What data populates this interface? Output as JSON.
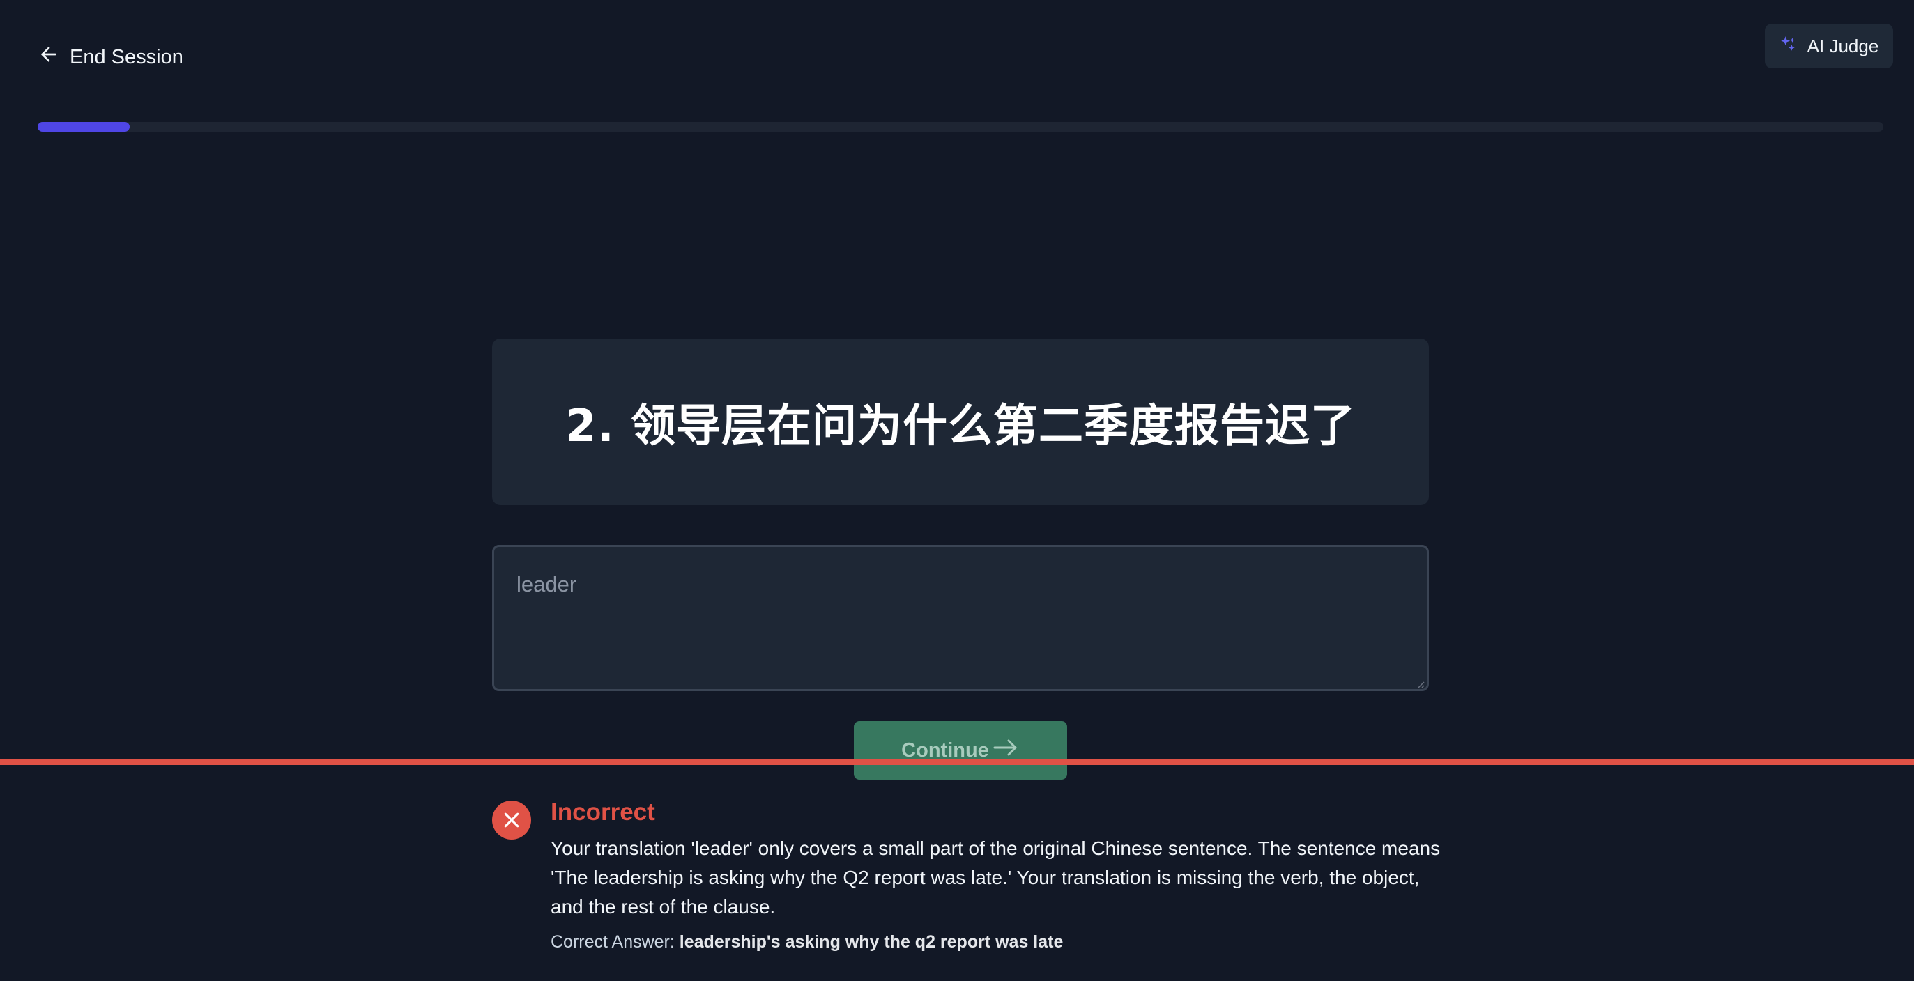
{
  "header": {
    "end_session_label": "End Session",
    "ai_judge_label": "AI Judge"
  },
  "progress": {
    "fraction": 0.05,
    "color": "#4f46e5"
  },
  "prompt": {
    "text": "2. 领导层在问为什么第二季度报告迟了"
  },
  "answer": {
    "value": "leader",
    "placeholder": ""
  },
  "continue_button": {
    "label": "Continue",
    "icon": "arrow-right-icon",
    "color": "#37785f"
  },
  "feedback": {
    "status": "Incorrect",
    "status_color": "#e05246",
    "icon": "x-circle-icon",
    "message": "Your translation 'leader' only covers a small part of the original Chinese sentence. The sentence means 'The leadership is asking why the Q2 report was late.' Your translation is missing the verb, the object, and the rest of the clause.",
    "correct_answer_label": "Correct Answer:",
    "correct_answer_value": "leadership's asking why the q2 report was late"
  }
}
